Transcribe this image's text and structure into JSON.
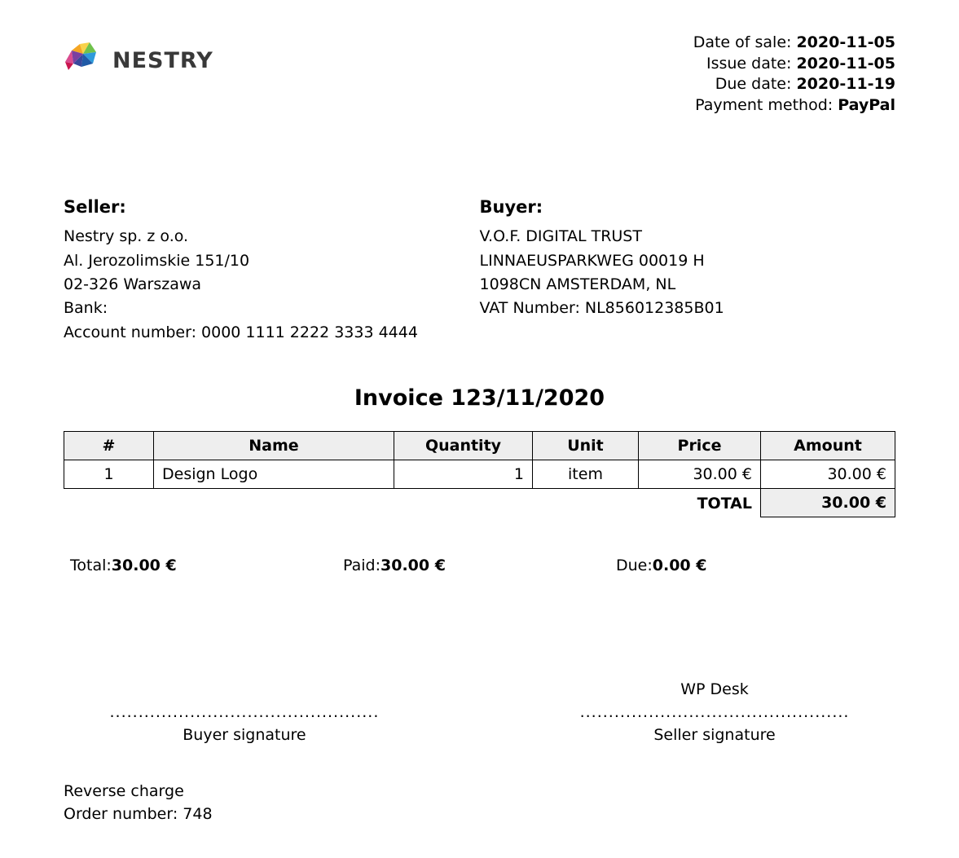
{
  "company": {
    "name": "NESTRY"
  },
  "meta": {
    "date_of_sale_label": "Date of sale:",
    "date_of_sale": "2020-11-05",
    "issue_date_label": "Issue date:",
    "issue_date": "2020-11-05",
    "due_date_label": "Due date:",
    "due_date": "2020-11-19",
    "payment_method_label": "Payment method:",
    "payment_method": "PayPal"
  },
  "seller": {
    "heading": "Seller:",
    "name": "Nestry sp. z o.o.",
    "street": "Al. Jerozolimskie 151/10",
    "city": "02-326 Warszawa",
    "bank_label": "Bank:",
    "account_label": "Account number: 0000 1111 2222 3333 4444"
  },
  "buyer": {
    "heading": "Buyer:",
    "name": "V.O.F. DIGITAL TRUST",
    "street": "LINNAEUSPARKWEG 00019 H",
    "city": "1098CN AMSTERDAM, NL",
    "vat": "VAT Number: NL856012385B01"
  },
  "invoice_title": "Invoice 123/11/2020",
  "table": {
    "headers": {
      "num": "#",
      "name": "Name",
      "qty": "Quantity",
      "unit": "Unit",
      "price": "Price",
      "amount": "Amount"
    },
    "row": {
      "num": "1",
      "name": "Design Logo",
      "qty": "1",
      "unit": "item",
      "price": "30.00 €",
      "amount": "30.00 €"
    },
    "total_label": "TOTAL",
    "total_value": "30.00 €"
  },
  "summary": {
    "total_label": "Total:",
    "total_value": "30.00 €",
    "paid_label": "Paid:",
    "paid_value": "30.00 €",
    "due_label": "Due:",
    "due_value": "0.00 €"
  },
  "signatures": {
    "buyer_name": "",
    "buyer_dots": "...............................................",
    "buyer_caption": "Buyer signature",
    "seller_name": "WP Desk",
    "seller_dots": "...............................................",
    "seller_caption": "Seller signature"
  },
  "footer": {
    "reverse_charge": "Reverse charge",
    "order_number": "Order number: 748"
  }
}
